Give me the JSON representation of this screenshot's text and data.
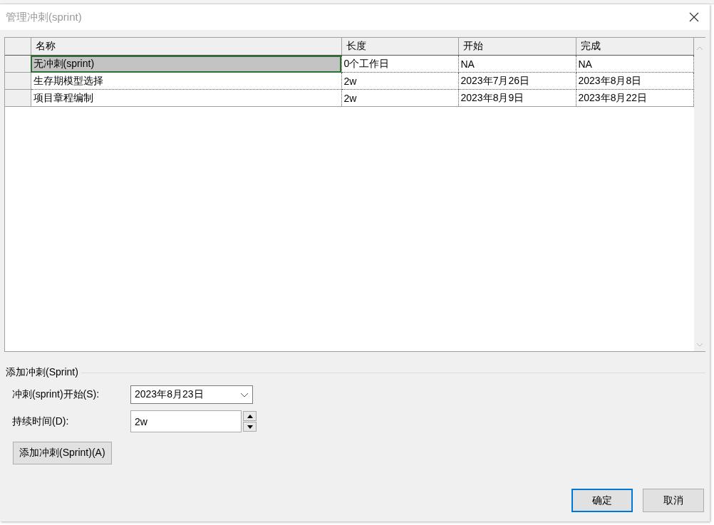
{
  "window": {
    "title": "管理冲刺(sprint)"
  },
  "table": {
    "columns": [
      "名称",
      "长度",
      "开始",
      "完成"
    ],
    "rows": [
      {
        "cells": [
          "无冲刺(sprint)",
          "0个工作日",
          "NA",
          "NA"
        ],
        "selected": true
      },
      {
        "cells": [
          "生存期模型选择",
          "2w",
          "2023年7月26日",
          "2023年8月8日"
        ],
        "selected": false
      },
      {
        "cells": [
          "项目章程编制",
          "2w",
          "2023年8月9日",
          "2023年8月22日"
        ],
        "selected": false
      }
    ]
  },
  "add_sprint": {
    "legend": "添加冲刺(Sprint)",
    "start_label": "冲刺(sprint)开始(S):",
    "start_value": "2023年8月23日",
    "duration_label": "持续时间(D):",
    "duration_value": "2w",
    "add_button": "添加冲刺(Sprint)(A)"
  },
  "buttons": [
    {
      "label": "确定",
      "default": true
    },
    {
      "label": "取消",
      "default": false
    }
  ]
}
